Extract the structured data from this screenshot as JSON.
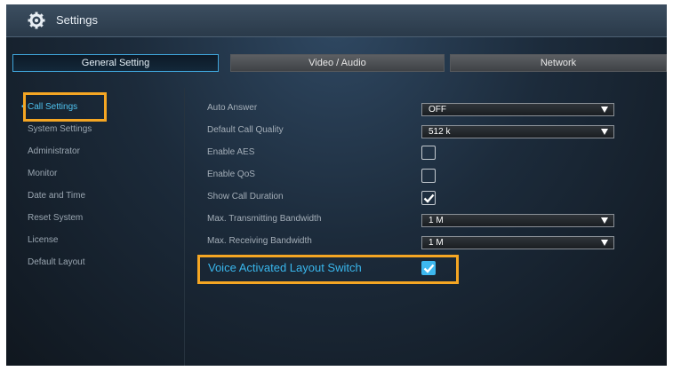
{
  "window": {
    "title": "Settings"
  },
  "tabs": [
    {
      "label": "General Setting",
      "active": true
    },
    {
      "label": "Video / Audio",
      "active": false
    },
    {
      "label": "Network",
      "active": false
    }
  ],
  "sidebar": {
    "items": [
      {
        "label": "Call Settings",
        "active": true
      },
      {
        "label": "System Settings",
        "active": false
      },
      {
        "label": "Administrator",
        "active": false
      },
      {
        "label": "Monitor",
        "active": false
      },
      {
        "label": "Date and Time",
        "active": false
      },
      {
        "label": "Reset System",
        "active": false
      },
      {
        "label": "License",
        "active": false
      },
      {
        "label": "Default Layout",
        "active": false
      }
    ]
  },
  "settings": {
    "auto_answer": {
      "label": "Auto Answer",
      "value": "OFF"
    },
    "default_call_quality": {
      "label": "Default Call Quality",
      "value": "512 k"
    },
    "enable_aes": {
      "label": "Enable AES",
      "checked": false
    },
    "enable_qos": {
      "label": "Enable QoS",
      "checked": false
    },
    "show_call_duration": {
      "label": "Show Call Duration",
      "checked": true
    },
    "max_transmitting_bandwidth": {
      "label": "Max. Transmitting Bandwidth",
      "value": "1 M"
    },
    "max_receiving_bandwidth": {
      "label": "Max. Receiving Bandwidth",
      "value": "1 M"
    },
    "voice_activated_layout_switch": {
      "label": "Voice Activated Layout Switch",
      "checked": true
    }
  },
  "colors": {
    "accent": "#3db8ef",
    "highlight": "#f5a623",
    "background": "#1c2b3b"
  },
  "icons": {
    "title_icon": "gear-icon",
    "dropdown_icon": "triangle-down-icon",
    "check_icon": "checkmark-icon"
  }
}
